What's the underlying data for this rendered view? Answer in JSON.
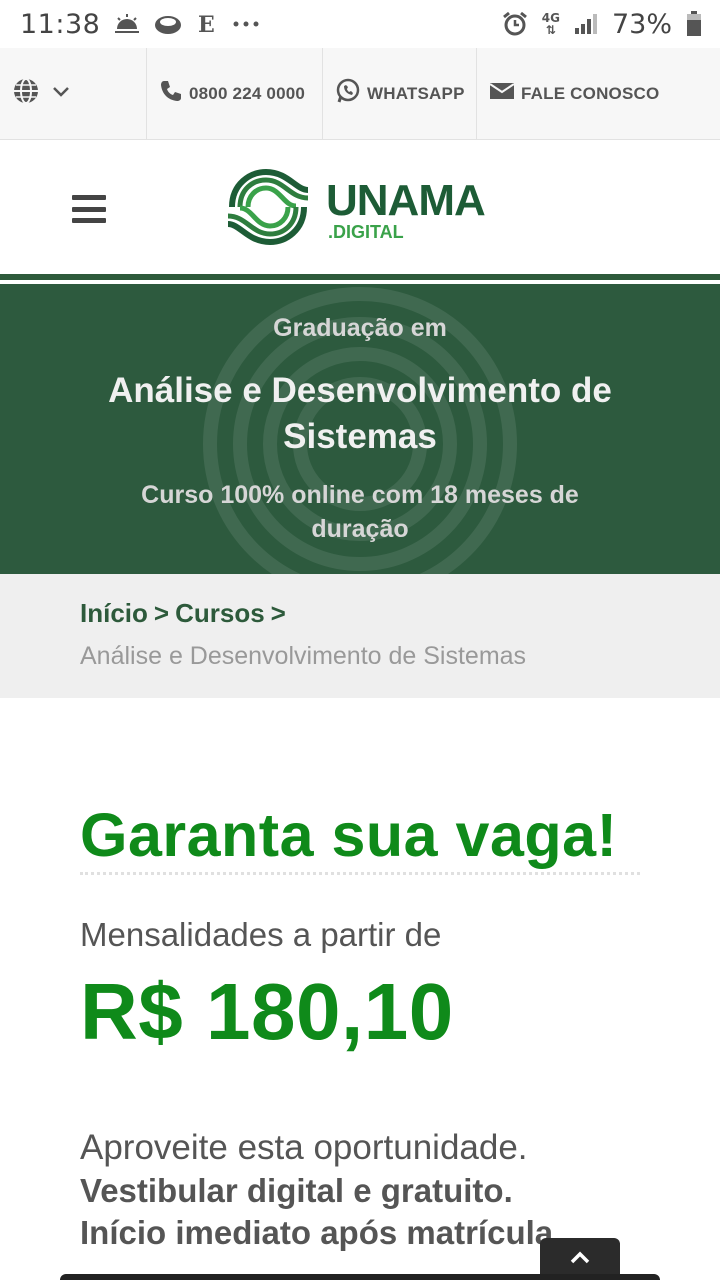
{
  "status_bar": {
    "time": "11:38",
    "network": "4G",
    "battery": "73%",
    "icons": [
      "weather-sun-icon",
      "cloud-icon",
      "e-news-icon",
      "more-dots-icon",
      "alarm-icon",
      "signal-icon",
      "battery-icon"
    ]
  },
  "utility_bar": {
    "language_icon": "globe-icon",
    "phone": "0800 224 0000",
    "whatsapp": "WHATSAPP",
    "contact": "FALE CONOSCO"
  },
  "header": {
    "logo_name": "UNAMA",
    "logo_sub": ".DIGITAL"
  },
  "hero": {
    "subtitle": "Graduação em",
    "title": "Análise e Desenvolvimento de Sistemas",
    "description": "Curso 100% online com 18 meses de duração"
  },
  "breadcrumb": {
    "home": "Início",
    "separator": ">",
    "courses": "Cursos",
    "current": "Análise e Desenvolvimento de Sistemas"
  },
  "main": {
    "cta_title": "Garanta sua vaga!",
    "price_label": "Mensalidades a partir de",
    "price_value": "R$ 180,10",
    "opportunity": "Aproveite esta oportunidade.",
    "free_exam": "Vestibular digital e gratuito.",
    "start": "Início imediato após matrícula"
  },
  "colors": {
    "brand_green": "#2d5a3e",
    "accent_green": "#0f8a1a",
    "logo_dark": "#1d5c36",
    "logo_light": "#3aa24a"
  }
}
